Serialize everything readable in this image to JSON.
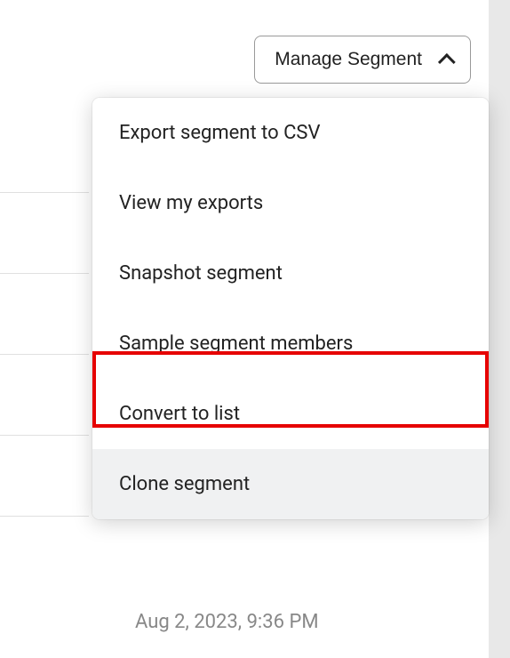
{
  "dropdown": {
    "button_label": "Manage Segment",
    "items": [
      {
        "label": "Export segment to CSV"
      },
      {
        "label": "View my exports"
      },
      {
        "label": "Snapshot segment"
      },
      {
        "label": "Sample segment members"
      },
      {
        "label": "Convert to list"
      },
      {
        "label": "Clone segment"
      }
    ]
  },
  "background": {
    "timestamp": "Aug 2, 2023, 9:36 PM"
  }
}
